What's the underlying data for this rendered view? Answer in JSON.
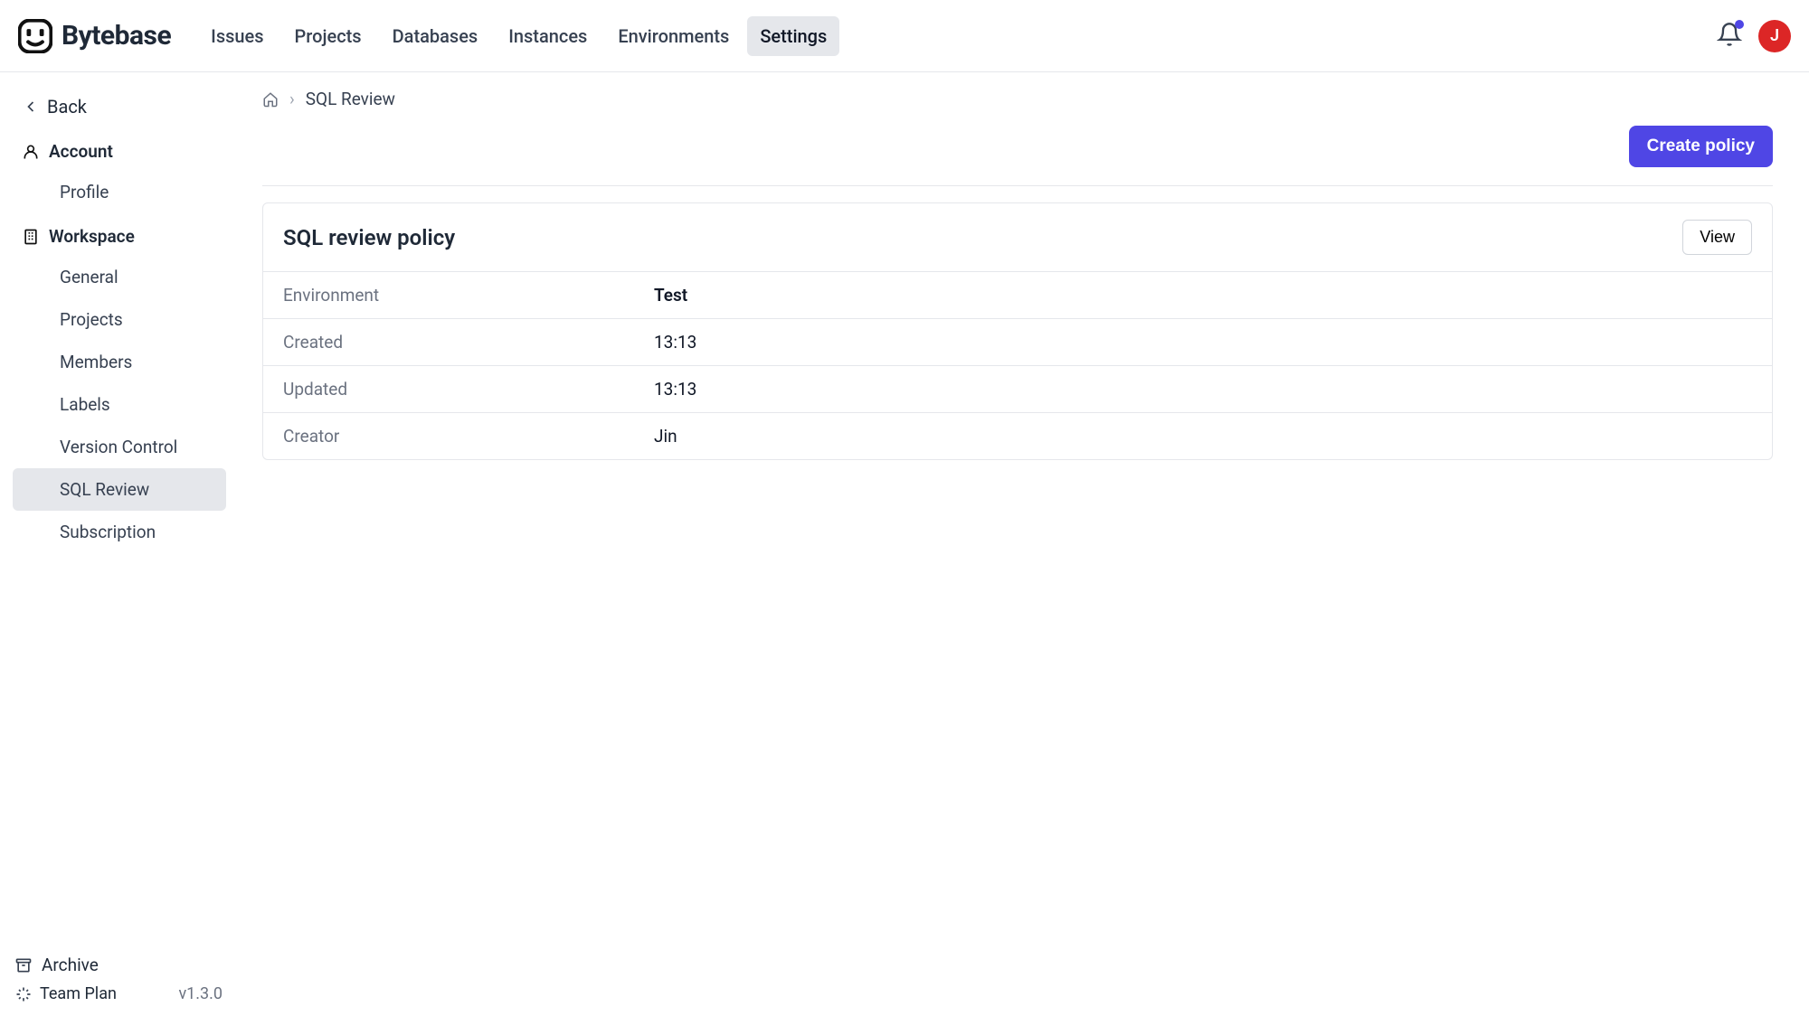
{
  "brand": "Bytebase",
  "nav": [
    {
      "label": "Issues"
    },
    {
      "label": "Projects"
    },
    {
      "label": "Databases"
    },
    {
      "label": "Instances"
    },
    {
      "label": "Environments"
    },
    {
      "label": "Settings",
      "active": true
    }
  ],
  "avatar_initial": "J",
  "sidebar": {
    "back": "Back",
    "sections": [
      {
        "title": "Account",
        "icon": "user",
        "items": [
          {
            "label": "Profile"
          }
        ]
      },
      {
        "title": "Workspace",
        "icon": "building",
        "items": [
          {
            "label": "General"
          },
          {
            "label": "Projects"
          },
          {
            "label": "Members"
          },
          {
            "label": "Labels"
          },
          {
            "label": "Version Control"
          },
          {
            "label": "SQL Review",
            "active": true
          },
          {
            "label": "Subscription"
          }
        ]
      }
    ],
    "archive": "Archive",
    "plan": "Team Plan",
    "version": "v1.3.0"
  },
  "breadcrumb": {
    "page": "SQL Review"
  },
  "actions": {
    "create": "Create policy"
  },
  "policy": {
    "title": "SQL review policy",
    "view": "View",
    "rows": [
      {
        "label": "Environment",
        "value": "Test",
        "strong": true
      },
      {
        "label": "Created",
        "value": "13:13"
      },
      {
        "label": "Updated",
        "value": "13:13"
      },
      {
        "label": "Creator",
        "value": "Jin"
      }
    ]
  }
}
